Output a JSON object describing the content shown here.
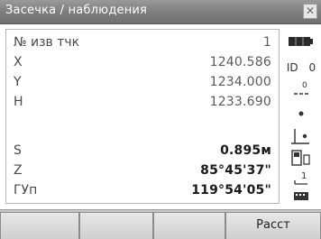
{
  "window": {
    "title": "Засечка / наблюдения"
  },
  "rows": [
    {
      "label": "№ изв тчк",
      "value": "1"
    },
    {
      "label": "X",
      "value": "1240.586"
    },
    {
      "label": "Y",
      "value": "1234.000"
    },
    {
      "label": "H",
      "value": "1233.690"
    },
    {
      "label": "S",
      "value": "0.895м"
    },
    {
      "label": "Z",
      "value": "85°45'37\""
    },
    {
      "label": "ГУп",
      "value": "119°54'05\""
    }
  ],
  "status": {
    "battery_icon": "battery-icon",
    "id_text": "ID",
    "id_value": "0",
    "prism_constant": "0",
    "target_icon": "target-dot-icon",
    "tilt_icon": "tilt-compensation-icon",
    "memory_icon": "memory-card-icon",
    "face_value": "1",
    "keyboard_icon": "keyboard-icon"
  },
  "softkeys": [
    "",
    "",
    "",
    "Расст"
  ]
}
